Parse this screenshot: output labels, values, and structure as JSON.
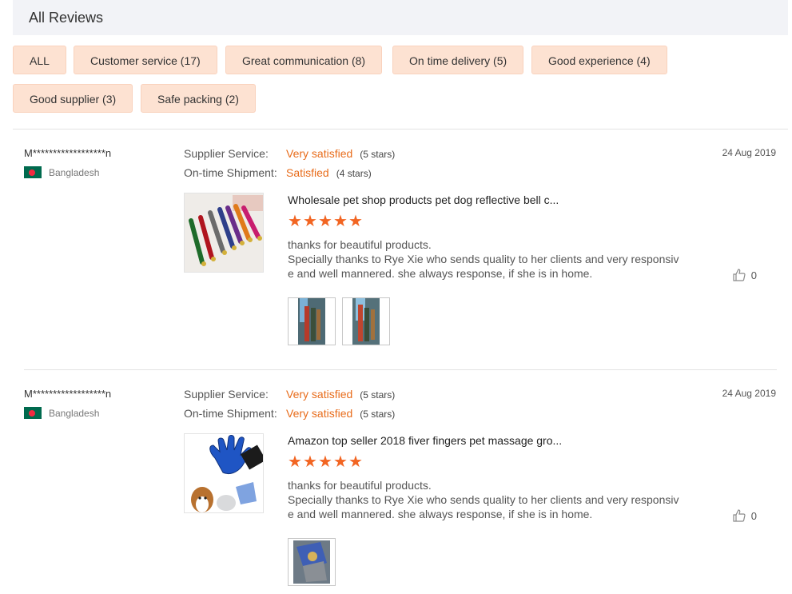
{
  "header": {
    "title": "All Reviews"
  },
  "tags": [
    {
      "label": "ALL"
    },
    {
      "label": "Customer service (17)"
    },
    {
      "label": "Great communication (8)"
    },
    {
      "label": "On time delivery (5)"
    },
    {
      "label": "Good experience (4)"
    },
    {
      "label": "Good supplier (3)"
    },
    {
      "label": "Safe packing (2)"
    }
  ],
  "reviews": [
    {
      "buyer": "M******************n",
      "country": "Bangladesh",
      "date": "24 Aug 2019",
      "supplier_service": {
        "label": "Supplier Service:",
        "value": "Very satisfied",
        "stars": "(5 stars)"
      },
      "shipment": {
        "label": "On-time Shipment:",
        "value": "Satisfied",
        "stars": "(4 stars)"
      },
      "product_title": "Wholesale pet shop products pet dog reflective bell c...",
      "product_rating": 5,
      "text_lines": [
        "thanks for beautiful products.",
        "Specially thanks to Rye Xie who sends quality to her clients and very responsiv",
        "e and well mannered. she always response,  if she is in home."
      ],
      "likes": "0",
      "photo_count": 2,
      "colors": {
        "accent": "#e86c1b",
        "star": "#f26522",
        "tag_bg": "#fde2d2"
      }
    },
    {
      "buyer": "M******************n",
      "country": "Bangladesh",
      "date": "24 Aug 2019",
      "supplier_service": {
        "label": "Supplier Service:",
        "value": "Very satisfied",
        "stars": "(5 stars)"
      },
      "shipment": {
        "label": "On-time Shipment:",
        "value": "Very satisfied",
        "stars": "(5 stars)"
      },
      "product_title": "Amazon top seller 2018 fiver fingers pet massage gro...",
      "product_rating": 5,
      "text_lines": [
        "thanks for beautiful products.",
        "Specially thanks to Rye Xie who sends quality to her clients and very responsiv",
        "e and well mannered. she always response,  if she is in home."
      ],
      "likes": "0",
      "photo_count": 1
    }
  ],
  "icons": {
    "like": "thumbs-up-icon",
    "flag": "bangladesh-flag-icon",
    "star": "star-icon"
  }
}
